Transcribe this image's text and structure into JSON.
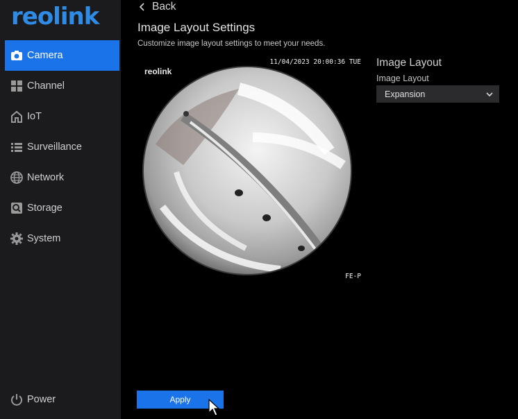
{
  "brand": {
    "logo_text": "reolink",
    "color": "#2f8ce6"
  },
  "sidebar": {
    "items": [
      {
        "label": "Camera",
        "icon": "camera-icon",
        "active": true
      },
      {
        "label": "Channel",
        "icon": "grid-icon",
        "active": false
      },
      {
        "label": "IoT",
        "icon": "house-icon",
        "active": false
      },
      {
        "label": "Surveillance",
        "icon": "list-icon",
        "active": false
      },
      {
        "label": "Network",
        "icon": "globe-icon",
        "active": false
      },
      {
        "label": "Storage",
        "icon": "storage-icon",
        "active": false
      },
      {
        "label": "System",
        "icon": "gear-icon",
        "active": false
      }
    ],
    "power_label": "Power"
  },
  "header": {
    "back_label": "Back",
    "title": "Image Layout Settings",
    "subtitle": "Customize image layout settings to meet your needs."
  },
  "preview": {
    "brand_text": "reolink",
    "timestamp": "11/04/2023 20:00:36 TUE",
    "code": "FE-P"
  },
  "settings": {
    "section_title": "Image Layout",
    "field_label": "Image Layout",
    "selected_value": "Expansion"
  },
  "actions": {
    "apply_label": "Apply"
  },
  "colors": {
    "accent": "#1a73e8",
    "sidebar_bg": "#1b1b1e"
  }
}
